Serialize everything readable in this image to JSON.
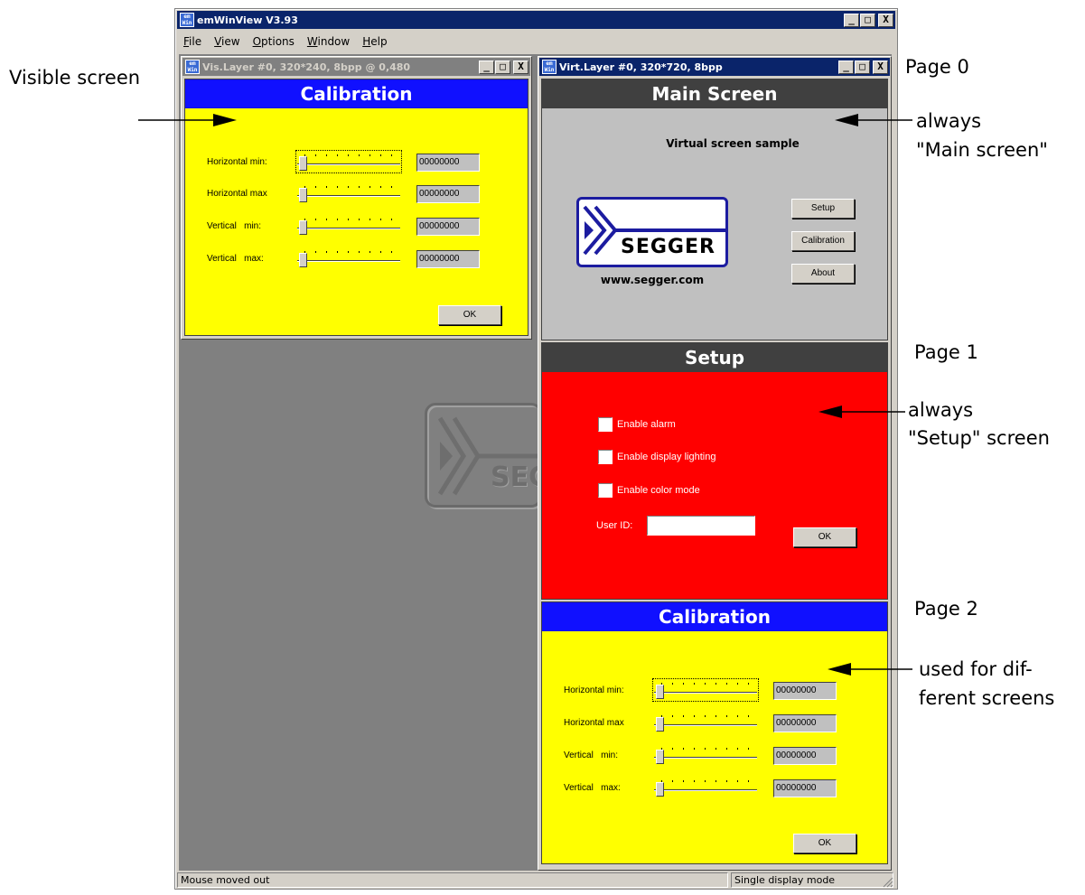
{
  "app": {
    "title": "emWinView V3.93",
    "icon_text": "em\nWin",
    "menu": [
      "File",
      "View",
      "Options",
      "Window",
      "Help"
    ]
  },
  "window_buttons": {
    "minimize": "_",
    "maximize": "□",
    "close": "X"
  },
  "visible_layer": {
    "title": "Vis.Layer #0, 320*240, 8bpp @ 0,480"
  },
  "virtual_layer": {
    "title": "Virt.Layer #0, 320*720, 8bpp"
  },
  "calibration": {
    "title": "Calibration",
    "rows": [
      {
        "label": "Horizontal min:",
        "value": "00000000"
      },
      {
        "label": "Horizontal max",
        "value": "00000000"
      },
      {
        "label": "Vertical   min:",
        "value": "00000000"
      },
      {
        "label": "Vertical   max:",
        "value": "00000000"
      }
    ],
    "ok_label": "OK"
  },
  "main_screen": {
    "title": "Main Screen",
    "subtitle": "Virtual screen sample",
    "logo_text": "SEGGER",
    "website": "www.segger.com",
    "buttons": [
      "Setup",
      "Calibration",
      "About"
    ]
  },
  "setup": {
    "title": "Setup",
    "checkboxes": [
      "Enable alarm",
      "Enable display lighting",
      "Enable color mode"
    ],
    "user_id_label": "User ID:",
    "user_id_value": "",
    "ok_label": "OK"
  },
  "background_logo_text": "SEG",
  "statusbar": {
    "left": "Mouse moved out",
    "right": "Single display mode"
  },
  "annotations": {
    "visible_screen": "Visible screen",
    "page0": "Page 0",
    "page0_note_1": "always",
    "page0_note_2": "\"Main screen\"",
    "page1": "Page 1",
    "page1_note_1": "always",
    "page1_note_2": "\"Setup\" screen",
    "page2": "Page 2",
    "page2_note_1": "used for dif-",
    "page2_note_2": "ferent screens"
  },
  "colors": {
    "title_bar": "#0a246a",
    "calibration_title": "#1010ff",
    "calibration_bg": "#ffff00",
    "main_title": "#404040",
    "main_bg": "#c0c0c0",
    "setup_bg": "#ff0000",
    "segger_blue": "#1c1ca0"
  }
}
